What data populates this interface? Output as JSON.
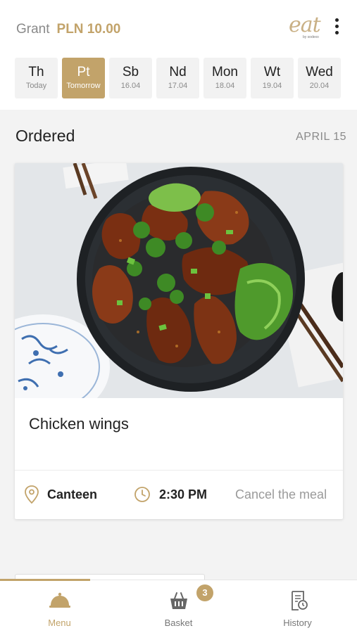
{
  "header": {
    "grant_label": "Grant",
    "grant_amount": "PLN 10.00",
    "logo_text": "eat",
    "logo_sub": "by sodexo",
    "menu_icon": "kebab-menu-icon"
  },
  "days": [
    {
      "name": "Th",
      "date": "Today",
      "active": false
    },
    {
      "name": "Pt",
      "date": "Tomorrow",
      "active": true
    },
    {
      "name": "Sb",
      "date": "16.04",
      "active": false
    },
    {
      "name": "Nd",
      "date": "17.04",
      "active": false
    },
    {
      "name": "Mon",
      "date": "18.04",
      "active": false
    },
    {
      "name": "Wt",
      "date": "19.04",
      "active": false
    },
    {
      "name": "Wed",
      "date": "20.04",
      "active": false
    }
  ],
  "ordered": {
    "title": "Ordered",
    "date": "APRIL 15",
    "card": {
      "image": "chicken-wings-photo",
      "meal_name": "Chicken wings",
      "location_icon": "location-pin-icon",
      "location": "Canteen",
      "time_icon": "clock-icon",
      "time": "2:30 PM",
      "cancel_label": "Cancel the meal"
    }
  },
  "tabbar": {
    "tabs": [
      {
        "label": "Menu",
        "icon": "cloche-icon",
        "active": true
      },
      {
        "label": "Basket",
        "icon": "basket-icon",
        "active": false,
        "badge": "3"
      },
      {
        "label": "History",
        "icon": "receipt-history-icon",
        "active": false
      }
    ]
  },
  "colors": {
    "accent": "#c2a36a",
    "text": "#222222",
    "muted": "#8a8a8a",
    "background": "#f3f3f3"
  }
}
